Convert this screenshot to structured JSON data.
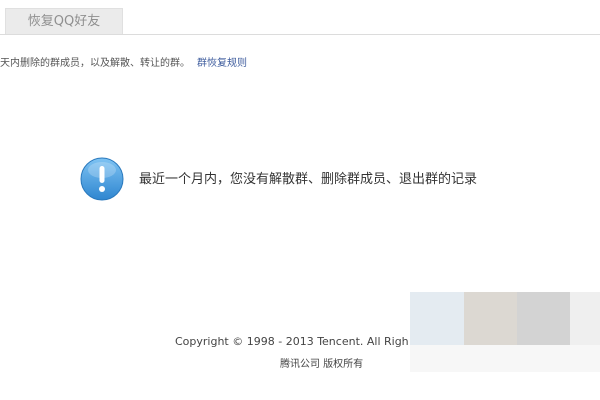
{
  "tab": {
    "label": "恢复QQ好友"
  },
  "notice": {
    "text": "天内删除的群成员，以及解散、转让的群。",
    "rule_link": "群恢复规则"
  },
  "empty_state": {
    "icon": "info-circle-icon",
    "message": "最近一个月内，您没有解散群、删除群成员、退出群的记录"
  },
  "footer": {
    "copyright": "Copyright © 1998 - 2013 Tencent. All Righ",
    "company": "腾讯公司 版权所有"
  },
  "colors": {
    "accent_icon": "#3a8fd6",
    "link": "#3f5d9e",
    "tab_background": "#ebebeb"
  }
}
